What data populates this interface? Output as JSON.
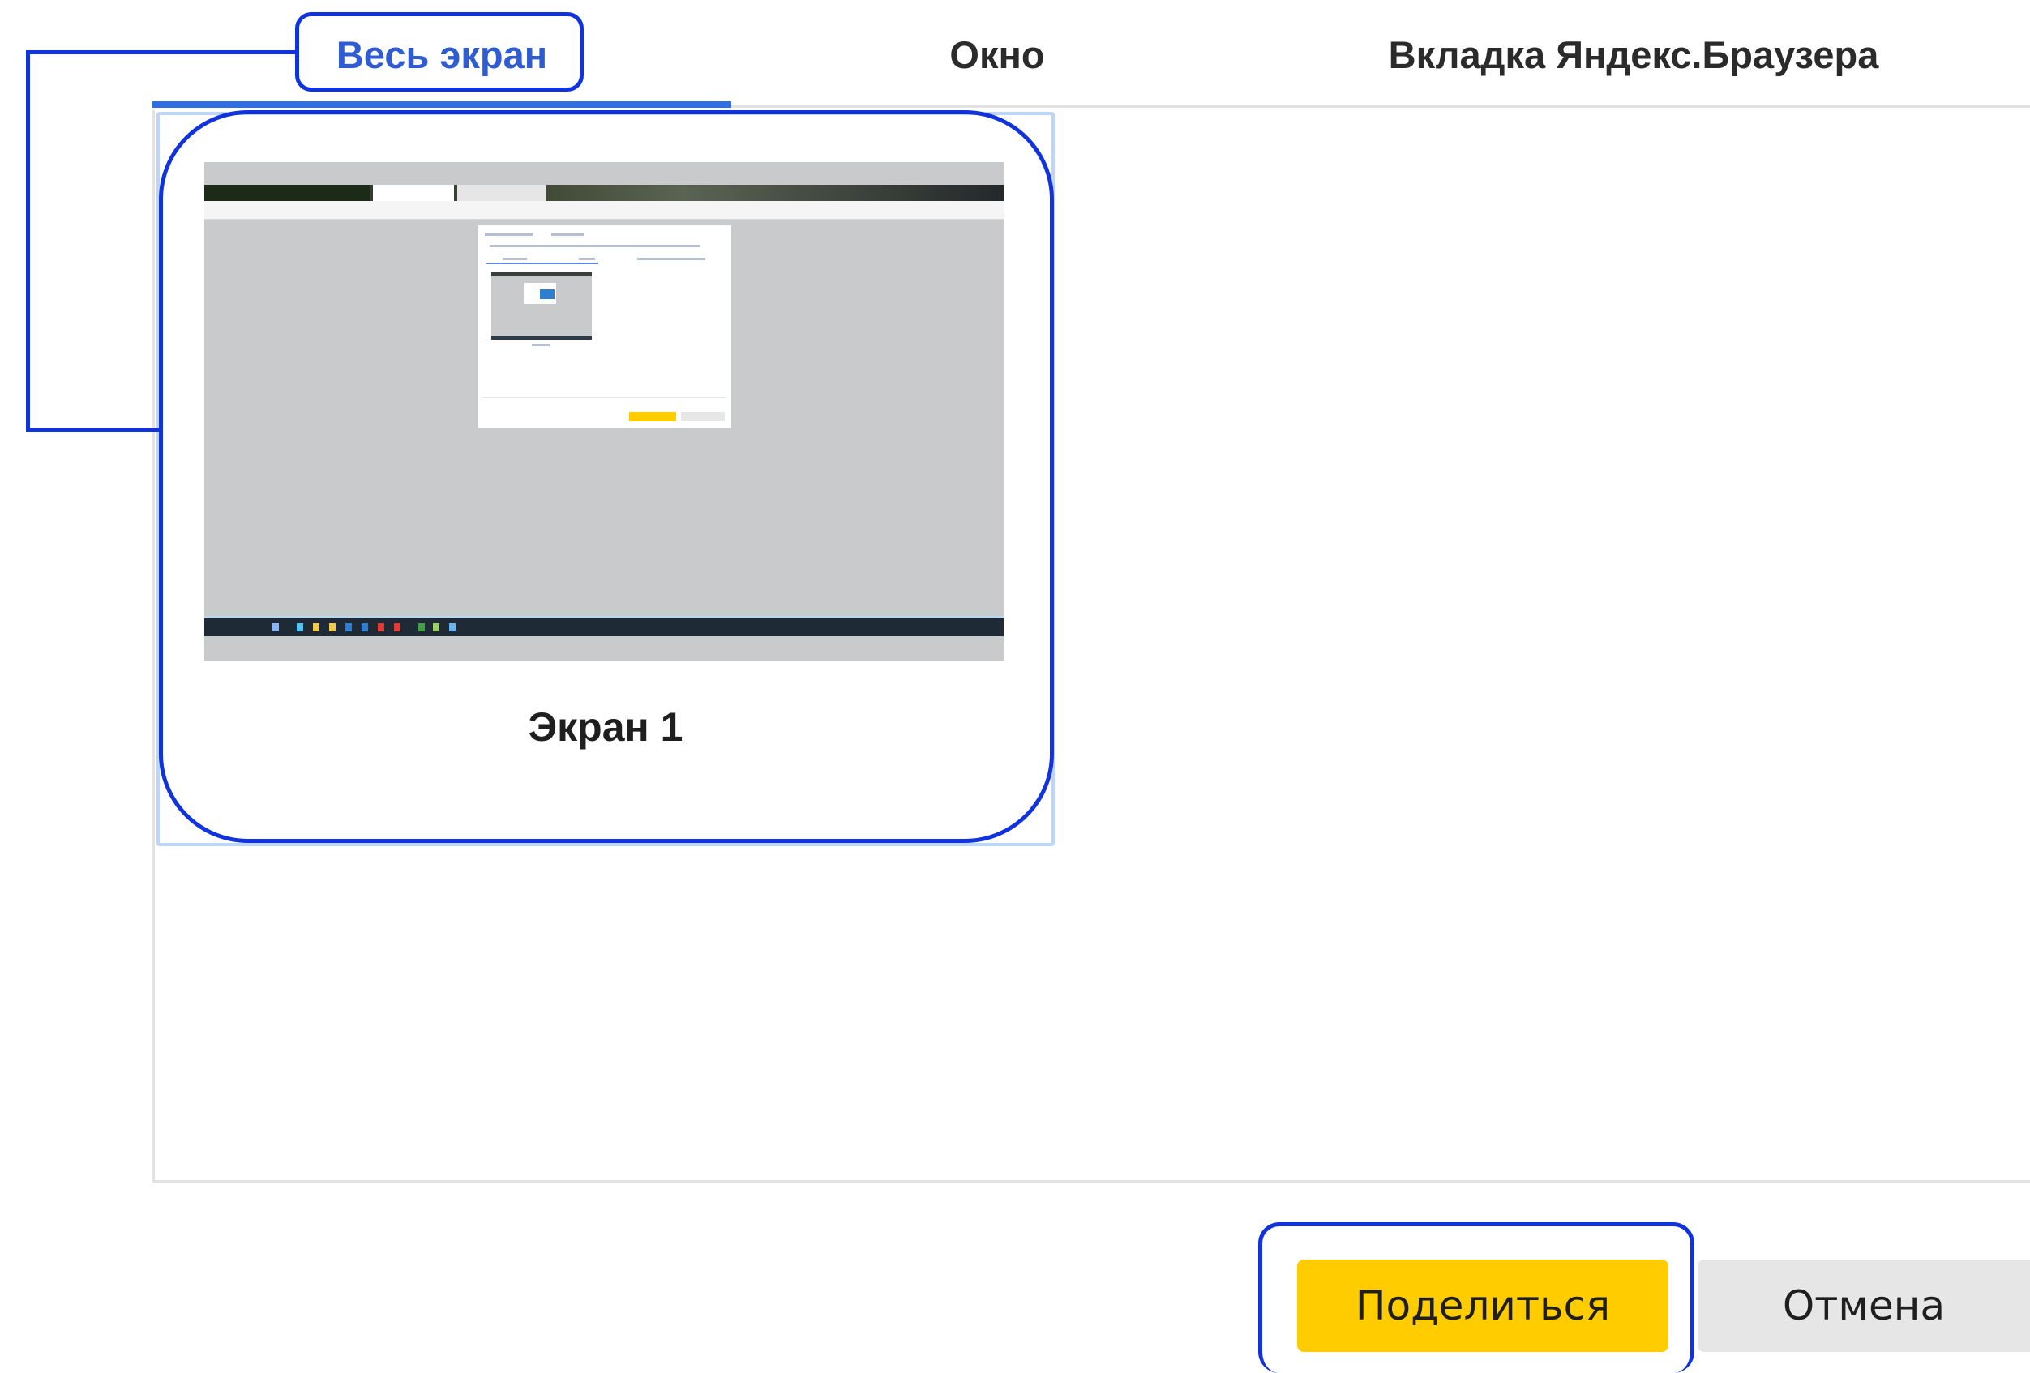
{
  "tabs": [
    {
      "label": "Весь экран",
      "active": true
    },
    {
      "label": "Окно",
      "active": false
    },
    {
      "label": "Вкладка Яндекс.Браузера",
      "active": false
    }
  ],
  "screens": [
    {
      "label": "Экран 1",
      "selected": true
    }
  ],
  "buttons": {
    "share": "Поделиться",
    "cancel": "Отмена"
  },
  "colors": {
    "accent": "#2f5bd3",
    "tab_underline": "#2f6fe6",
    "share_button": "#ffcc00",
    "cancel_button": "#e6e6e6",
    "annotation": "#1133dd",
    "selection_border": "#bdd5f7"
  }
}
